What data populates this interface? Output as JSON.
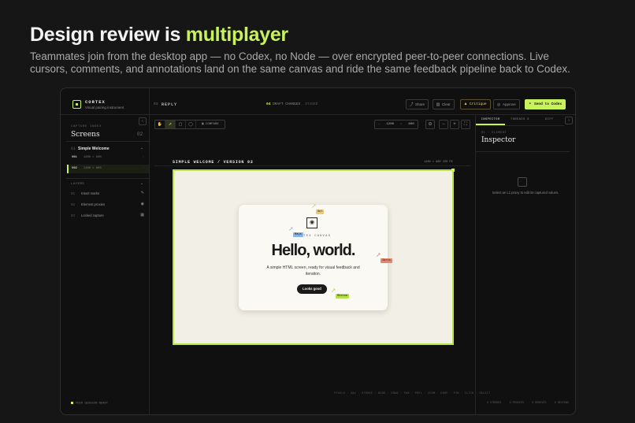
{
  "hero": {
    "title_pre": "Design review is ",
    "title_accent": "multiplayer",
    "subtitle": "Teammates join from the desktop app — no Codex, no Node — over encrypted peer-to-peer connections. Live cursors, comments, and annotations land on the same canvas and ride the same feedback pipeline back to Codex."
  },
  "app": {
    "brand": "CORTEX",
    "brand_sub": "Visual pairing instrument",
    "reply_num": "03",
    "reply_label": "REPLY",
    "drafts_count": "04",
    "drafts_label": "DRAFT CHANGES",
    "drafts_extra": "STAGED",
    "actions": {
      "share": "Share",
      "clear": "Clear",
      "critique": "Critique",
      "approve": "Approve",
      "send": "Send to Codex"
    },
    "colors": {
      "accent": "#c8f25a",
      "background": "#101010",
      "canvas": "#f2efe6"
    }
  },
  "sidebar": {
    "caption": "CAPTURE INDEX",
    "title": "Screens",
    "count": "02",
    "group_num": "01",
    "group_name": "Simple Welcome",
    "versions": [
      {
        "tag": "V01",
        "size": "1280 × 800",
        "active": false
      },
      {
        "tag": "V02",
        "size": "1280 × 800",
        "active": true
      }
    ],
    "layers_title": "LAYERS",
    "layers": [
      {
        "num": "01",
        "label": "Insert marks",
        "icon": "pen-icon"
      },
      {
        "num": "02",
        "label": "Element proxies",
        "icon": "target-icon"
      },
      {
        "num": "03",
        "label": "Locked capture",
        "icon": "grid-icon"
      }
    ],
    "footer": "PEER SESSION READY"
  },
  "canvas": {
    "compare_label": "COMPARE",
    "width": "1280",
    "height": "800",
    "frame_title_a": "SIMPLE WELCOME",
    "frame_title_b": "VERSION 02",
    "frame_dims": "1280 × 800 CSS PX",
    "card": {
      "brand": "CORTEX CANVAS",
      "headline": "Hello, world.",
      "description": "A simple HTML screen, ready for visual feedback and iteration.",
      "button": "Looks good"
    },
    "cursors": [
      {
        "name": "Sol",
        "color": "#e8c97a"
      },
      {
        "name": "Maya",
        "color": "#8ab4e8"
      },
      {
        "name": "Idris",
        "color": "#e8876a"
      },
      {
        "name": "Rhenna",
        "color": "#b8e04a"
      }
    ],
    "stats_footer": "PIXELS · 384 · STROKE · NODE · DRAG · PAN · PEEL · ZOOM · DROP · PIN · CLICK · SELECT"
  },
  "inspector": {
    "tabs": [
      "INSPECTOR",
      "THREADS 0",
      "DIFF"
    ],
    "caption": "01 · ELEMENT",
    "title": "Inspector",
    "empty_text": "Select an L1 proxy to edit its captured values.",
    "footer": [
      "0 STROKES",
      "0 PROXIES",
      "0 REMOVES",
      "0 REVIEWS"
    ]
  }
}
